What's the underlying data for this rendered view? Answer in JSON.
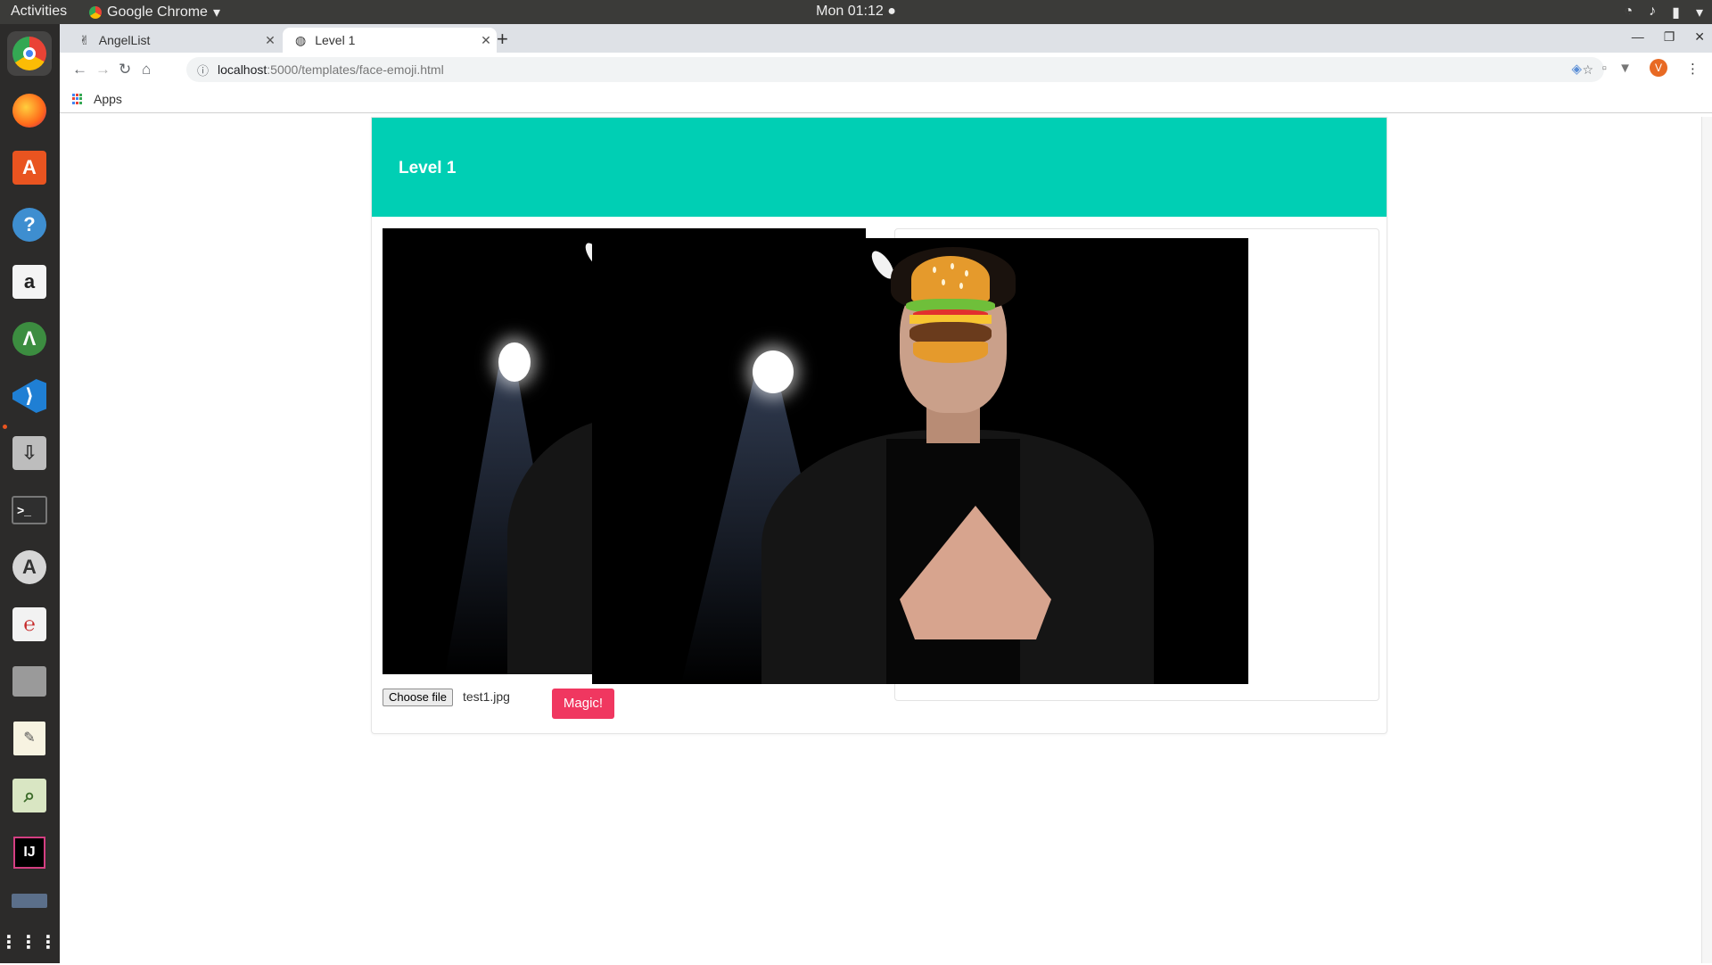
{
  "system": {
    "activities_label": "Activities",
    "app_name": "Google Chrome",
    "clock": "Mon 01:12"
  },
  "browser": {
    "tabs": [
      {
        "title": "AngelList",
        "icon": "angellist-icon",
        "active": false
      },
      {
        "title": "Level 1",
        "icon": "globe-icon",
        "active": true
      }
    ],
    "url_host": "localhost",
    "url_path": ":5000/templates/face-emoji.html",
    "bookmarks_label": "Apps",
    "avatar_letter": "V"
  },
  "page": {
    "header_title": "Level 1",
    "header_color": "#00cfb4",
    "file_button_label": "Choose file",
    "file_name": "test1.jpg",
    "magic_button_label": "Magic!",
    "magic_button_color": "#f03760",
    "overlay_emoji": "hamburger"
  },
  "dock": [
    "chrome-icon",
    "firefox-icon",
    "software-center-icon",
    "help-icon",
    "amazon-icon",
    "android-studio-icon",
    "vscode-icon",
    "installer-icon",
    "terminal-icon",
    "updater-icon",
    "pdf-viewer-icon",
    "archive-icon",
    "text-editor-icon",
    "image-viewer-icon",
    "intellij-icon",
    "drive-icon",
    "show-apps-icon"
  ]
}
